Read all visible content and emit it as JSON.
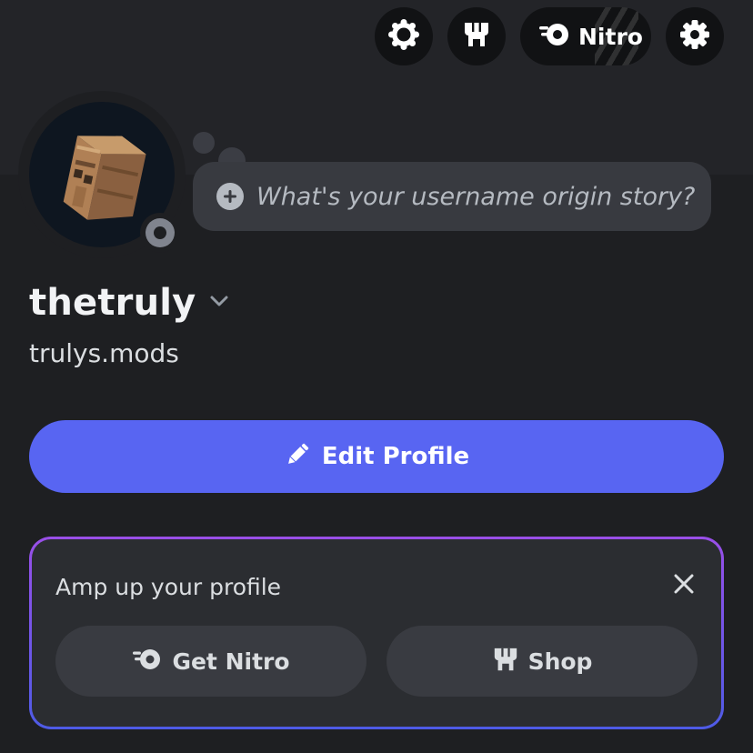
{
  "header": {
    "actions": [
      {
        "icon": "badge-icon"
      },
      {
        "icon": "shop-icon"
      },
      {
        "icon": "nitro-icon",
        "label": "Nitro"
      },
      {
        "icon": "gear-icon"
      }
    ]
  },
  "profile": {
    "status_placeholder": "What's your username origin story?",
    "display_name": "thetruly",
    "username": "trulys.mods",
    "status": "offline",
    "status_color": "#80848e"
  },
  "edit_profile": {
    "label": "Edit Profile",
    "color": "#5865f2"
  },
  "amp_card": {
    "title": "Amp up your profile",
    "get_nitro_label": "Get Nitro",
    "shop_label": "Shop",
    "gradient_colors": [
      "#9a4fe8",
      "#4e5be6"
    ]
  }
}
